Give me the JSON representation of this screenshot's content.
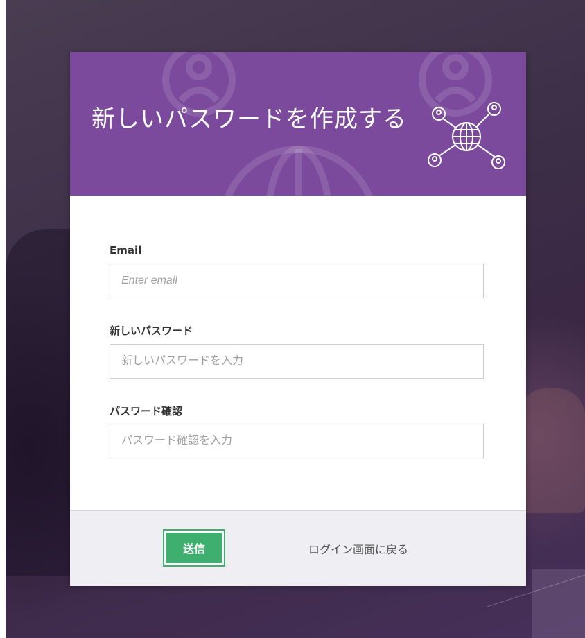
{
  "header": {
    "title": "新しいパスワードを作成する",
    "accent_color": "#7c4a9d",
    "icon": "globe-network-icon"
  },
  "form": {
    "email": {
      "label": "Email",
      "placeholder": "Enter email",
      "value": ""
    },
    "new_password": {
      "label": "新しいパスワード",
      "placeholder": "新しいパスワードを入力",
      "value": ""
    },
    "confirm_password": {
      "label": "パスワード確認",
      "placeholder": "パスワード確認を入力",
      "value": ""
    }
  },
  "footer": {
    "submit_label": "送信",
    "submit_color": "#3eaf6e",
    "back_link": "ログイン画面に戻る"
  }
}
